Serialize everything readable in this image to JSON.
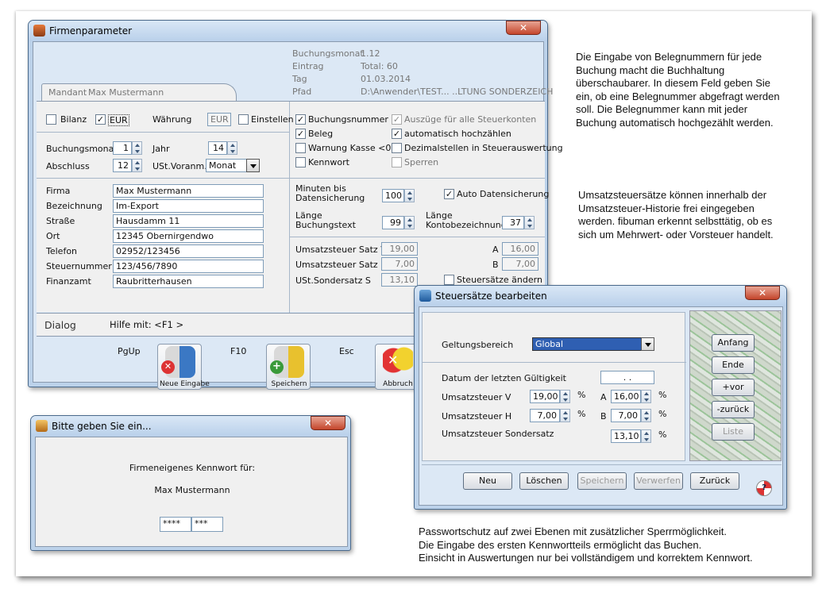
{
  "main_window": {
    "title": "Firmenparameter",
    "close": "✕",
    "info": {
      "buchungsmonat_label": "Buchungsmonat",
      "buchungsmonat": "1.12",
      "eintrag_label": "Eintrag",
      "eintrag": "Total: 60",
      "tag_label": "Tag",
      "tag": "01.03.2014",
      "pfad_label": "Pfad",
      "pfad": "D:\\Anwender\\TEST... ..LTUNG SONDERZEICH"
    },
    "tab": {
      "label": "Mandant",
      "value": "Max Mustermann"
    },
    "top": {
      "bilanz": "Bilanz",
      "eur": "EUR",
      "waehrung": "Währung",
      "waehrung_value": "EUR",
      "einstellen": "Einstellen"
    },
    "period": {
      "buchungsmonat_label": "Buchungsmonat",
      "buchungsmonat": "1",
      "jahr_label": "Jahr",
      "jahr": "14",
      "abschluss_label": "Abschluss",
      "abschluss": "12",
      "ust_label": "USt.Voranm.",
      "ust": "Monat"
    },
    "fields": [
      {
        "label": "Firma",
        "value": "Max Mustermann"
      },
      {
        "label": "Bezeichnung",
        "value": "Im-Export"
      },
      {
        "label": "Straße",
        "value": "Hausdamm 11"
      },
      {
        "label": "Ort",
        "value": "12345 Obernirgendwo"
      },
      {
        "label": "Telefon",
        "value": "02952/123456"
      },
      {
        "label": "Steuernummer",
        "value": "123/456/7890"
      },
      {
        "label": "Finanzamt",
        "value": "Raubritterhausen"
      }
    ],
    "options": {
      "buchungsnummer": "Buchungsnummer",
      "auszuege": "Auszüge für alle Steuerkonten",
      "beleg": "Beleg",
      "hochzaehlen": "automatisch hochzählen",
      "warnung": "Warnung Kasse <0",
      "dezimal": "Dezimalstellen in Steuerauswertung",
      "kennwort": "Kennwort",
      "sperren": "Sperren"
    },
    "save": {
      "minuten_label": "Minuten bis Datensicherung",
      "minuten": "100",
      "auto": "Auto Datensicherung",
      "laenge_buchung_label": "Länge Buchungstext",
      "laenge_buchung": "99",
      "laenge_konto_label": "Länge Kontobezeichnung",
      "laenge_konto": "37"
    },
    "tax": {
      "v_label": "Umsatzsteuer Satz V",
      "v": "19,00",
      "a_label": "A",
      "a": "16,00",
      "h_label": "Umsatzsteuer Satz H",
      "h": "7,00",
      "b_label": "B",
      "b": "7,00",
      "s_label": "USt.Sondersatz S",
      "s": "13,10",
      "aendern": "Steuersätze ändern"
    },
    "dialog": {
      "label": "Dialog",
      "hilfe": "Hilfe mit: <F1 >"
    },
    "keys": {
      "pgup": "PgUp",
      "f10": "F10",
      "esc": "Esc"
    },
    "buttons": {
      "neue": "Neue Eingabe",
      "speichern": "Speichern",
      "abbruch": "Abbruch"
    }
  },
  "tax_window": {
    "title": "Steuersätze bearbeiten",
    "close": "✕",
    "geltung_label": "Geltungsbereich",
    "geltung": "Global",
    "datum_label": "Datum der letzten Gültigkeit",
    "datum": ". .",
    "v_label": "Umsatzsteuer V",
    "v": "19,00",
    "a_label": "A",
    "a": "16,00",
    "h_label": "Umsatzsteuer H",
    "h": "7,00",
    "b_label": "B",
    "b": "7,00",
    "s_label": "Umsatzsteuer Sondersatz",
    "s": "13,10",
    "pct": "%",
    "side": [
      "Anfang",
      "Ende",
      "+vor",
      "-zurück",
      "Liste"
    ],
    "bottom": [
      "Neu",
      "Löschen",
      "Speichern",
      "Verwerfen",
      "Zurück"
    ]
  },
  "pw_window": {
    "title": "Bitte geben Sie ein...",
    "close": "✕",
    "prompt": "Firmeneigenes Kennwort für:",
    "name": "Max Mustermann",
    "pw1": "****",
    "pw2": "***"
  },
  "notes": {
    "n1": "Die Eingabe von Belegnummern für jede Buchung macht die Buchhaltung überschaubarer. In diesem Feld geben Sie ein, ob eine Belegnummer abgefragt werden soll. Die Belegnummer kann mit jeder Buchung automatisch hochgezählt werden.",
    "n2": "Umsatzsteuersätze können innerhalb der Umsatzsteuer-Historie frei eingegeben werden. fibuman erkennt selbsttätig, ob es sich um Mehrwert- oder Vorsteuer handelt.",
    "n3": [
      "Passwortschutz auf zwei Ebenen mit zusätzlicher Sperrmöglichkeit.",
      "Die Eingabe des ersten Kennwortteils ermöglicht das Buchen.",
      "Einsicht in Auswertungen nur bei vollständigem und korrektem Kennwort."
    ]
  }
}
